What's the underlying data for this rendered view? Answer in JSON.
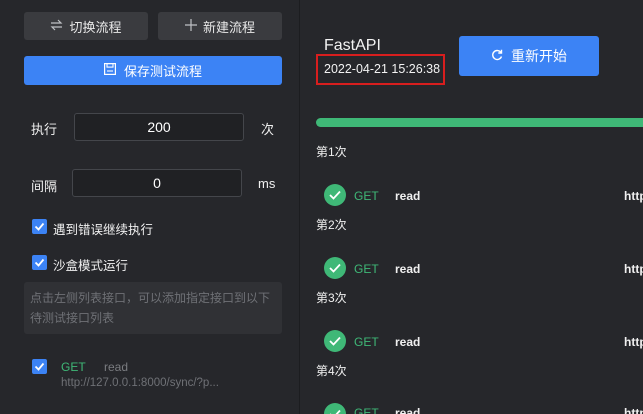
{
  "left_panel": {
    "switch_flow_label": "切换流程",
    "new_flow_label": "新建流程",
    "save_flow_label": "保存测试流程",
    "execute_label": "执行",
    "execute_value": "200",
    "execute_unit": "次",
    "interval_label": "间隔",
    "interval_value": "0",
    "interval_unit": "ms",
    "continue_on_error_label": "遇到错误继续执行",
    "continue_on_error_checked": true,
    "sandbox_label": "沙盒模式运行",
    "sandbox_checked": true,
    "hint_text": "点击左侧列表接口，可以添加指定接口到以下待测试接口列表",
    "api_item": {
      "checked": true,
      "method": "GET",
      "name": "read",
      "url": "http://127.0.0.1:8000/sync/?p..."
    }
  },
  "right_panel": {
    "app_title": "FastAPI",
    "timestamp": "2022-04-21 15:26:38",
    "restart_label": "重新开始",
    "progress_fraction": 1.0,
    "accent_color": "#3c83f5",
    "success_color": "#3fb877",
    "highlight_color": "#d81e1e",
    "rounds": [
      {
        "label": "第1次",
        "method": "GET",
        "name": "read",
        "url": "http"
      },
      {
        "label": "第2次",
        "method": "GET",
        "name": "read",
        "url": "http"
      },
      {
        "label": "第3次",
        "method": "GET",
        "name": "read",
        "url": "http"
      },
      {
        "label": "第4次",
        "method": "GET",
        "name": "read",
        "url": "http"
      }
    ]
  }
}
